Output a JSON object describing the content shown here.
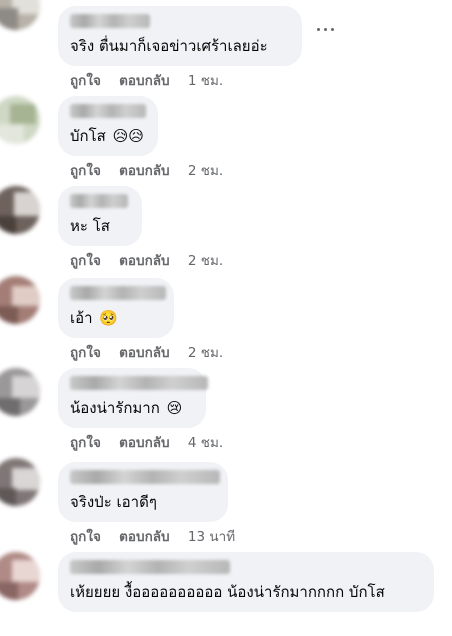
{
  "comments": [
    {
      "text": "จริง ตื่นมาก็เจอข่าวเศร้าเลยอ่ะ",
      "emoji": "",
      "like_label": "ถูกใจ",
      "reply_label": "ตอบกลับ",
      "time": "1 ชม.",
      "has_more_menu": true,
      "more_icon": "ellipsis-icon",
      "avatar_colors": [
        "#b8b2a8",
        "#e2e0da",
        "#8e8a85"
      ]
    },
    {
      "text": "บักโส",
      "emoji": "😥😥",
      "like_label": "ถูกใจ",
      "reply_label": "ตอบกลับ",
      "time": "2 ชม.",
      "has_more_menu": false,
      "avatar_colors": [
        "#cfd8c5",
        "#a6b493",
        "#e3e6dc"
      ]
    },
    {
      "text": "หะ โส",
      "emoji": "",
      "like_label": "ถูกใจ",
      "reply_label": "ตอบกลับ",
      "time": "2 ชม.",
      "has_more_menu": false,
      "avatar_colors": [
        "#6e625c",
        "#d8d3d0",
        "#4a403c"
      ]
    },
    {
      "text": "เอ้า",
      "emoji": "🥺",
      "like_label": "ถูกใจ",
      "reply_label": "ตอบกลับ",
      "time": "2 ชม.",
      "has_more_menu": false,
      "avatar_colors": [
        "#a47e76",
        "#e0ccc6",
        "#7d5c56"
      ]
    },
    {
      "text": "น้องน่ารักมาก",
      "emoji": "😢",
      "like_label": "ถูกใจ",
      "reply_label": "ตอบกลับ",
      "time": "4 ชม.",
      "has_more_menu": false,
      "avatar_colors": [
        "#9a9898",
        "#d6d4d4",
        "#6f6d6d"
      ]
    },
    {
      "text": "จริงป่ะ เอาดีๆ",
      "emoji": "",
      "like_label": "ถูกใจ",
      "reply_label": "ตอบกลับ",
      "time": "13 นาที",
      "has_more_menu": false,
      "avatar_colors": [
        "#7f7775",
        "#d9d6d5",
        "#5f5856"
      ]
    },
    {
      "text": "เห้ยยยย งื้ออออออออออ น้องน่ารักมากกกก บักโส",
      "emoji": "",
      "like_label": "",
      "reply_label": "",
      "time": "",
      "has_more_menu": false,
      "avatar_colors": [
        "#b08a86",
        "#e8d6d3",
        "#8a6663"
      ]
    }
  ]
}
